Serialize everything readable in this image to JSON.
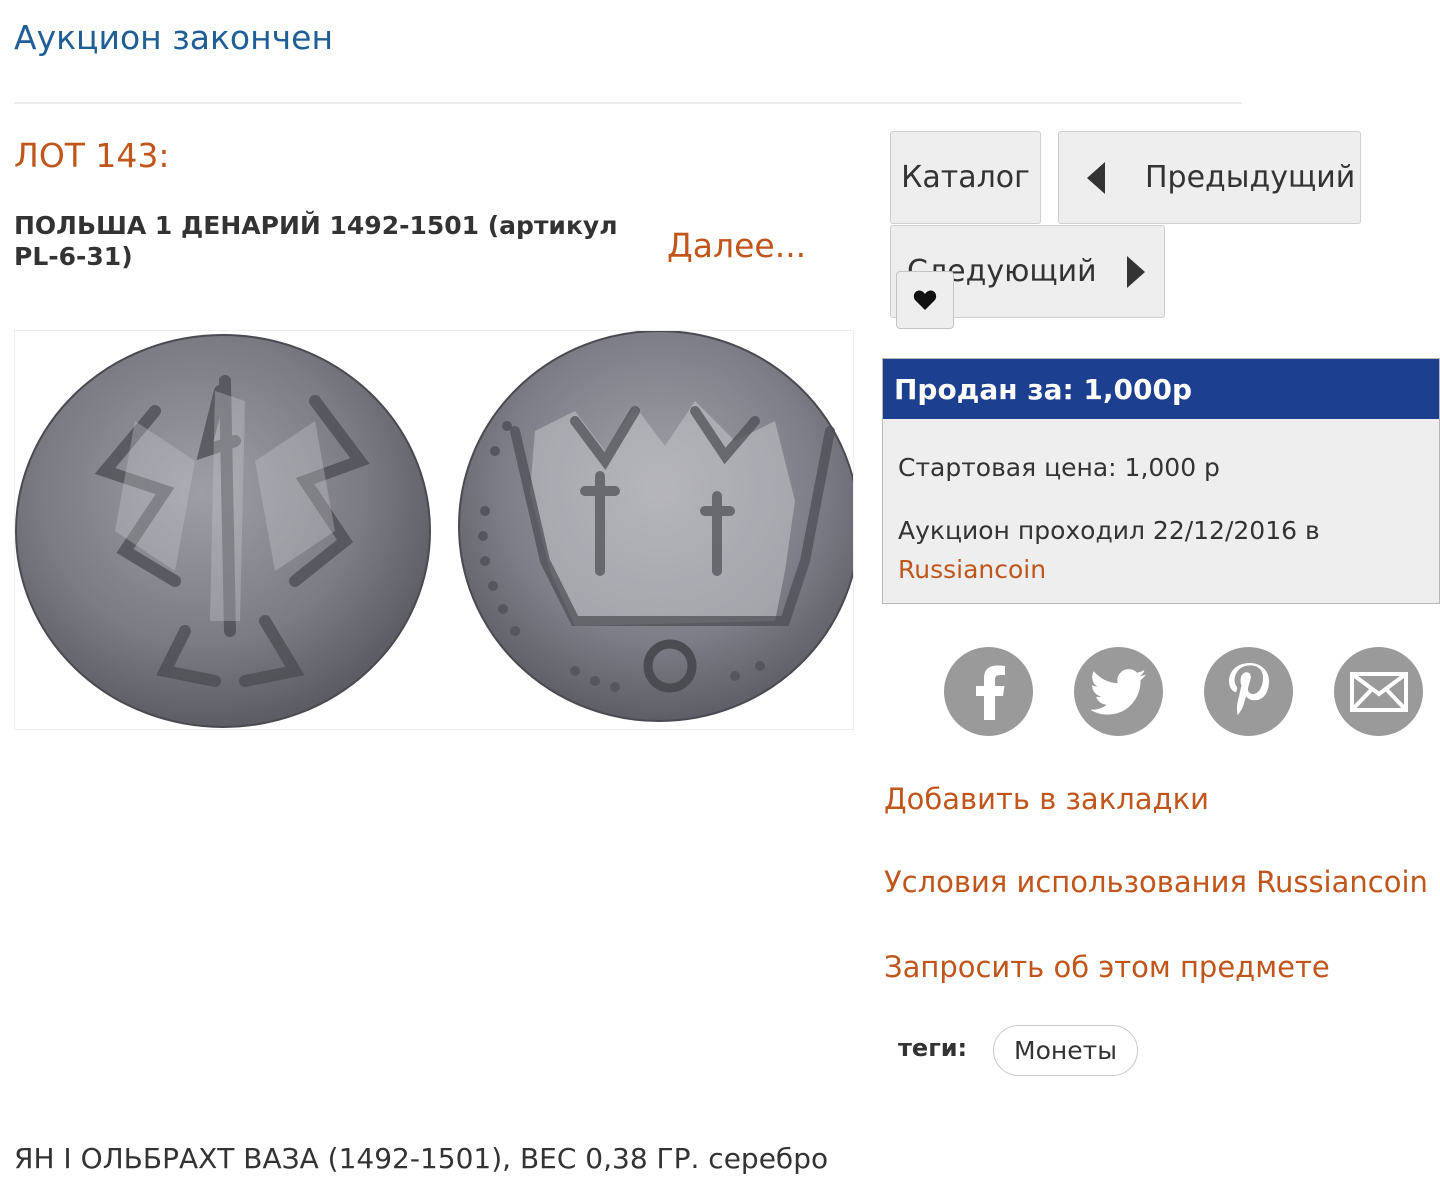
{
  "header": {
    "status": "Аукцион закончен"
  },
  "lot": {
    "number_label": "ЛОТ 143:",
    "title": "ПОЛЬША 1 ДЕНАРИЙ 1492-1501 (артикул PL-6-31)",
    "more_link": "Далее...",
    "description": "ЯН I ОЛЬБРАХТ ВАЗА (1492-1501), ВЕС 0,38 ГР. серебро"
  },
  "navigation": {
    "catalog": "Каталог",
    "previous": "Предыдущий",
    "next": "Следующий"
  },
  "price_box": {
    "sold_for": "Продан за: 1,000р",
    "start_price": "Стартовая цена: 1,000 р",
    "auction_date": "Аукцион проходил 22/12/2016 в",
    "auction_house": "Russiancoin"
  },
  "share": {
    "icons": [
      "facebook-icon",
      "twitter-icon",
      "pinterest-icon",
      "email-icon"
    ],
    "icon_color": "#9a9a9a"
  },
  "links": {
    "bookmark": "Добавить в закладки",
    "terms": "Условия использования Russiancoin",
    "inquire": "Запросить об этом предмете"
  },
  "tags": {
    "label": "теги:",
    "items": [
      "Монеты"
    ]
  },
  "colors": {
    "title_blue": "#1f5f96",
    "accent_orange": "#c0561b",
    "price_header": "#1c3f8f",
    "panel_gray": "#eeeeee"
  }
}
